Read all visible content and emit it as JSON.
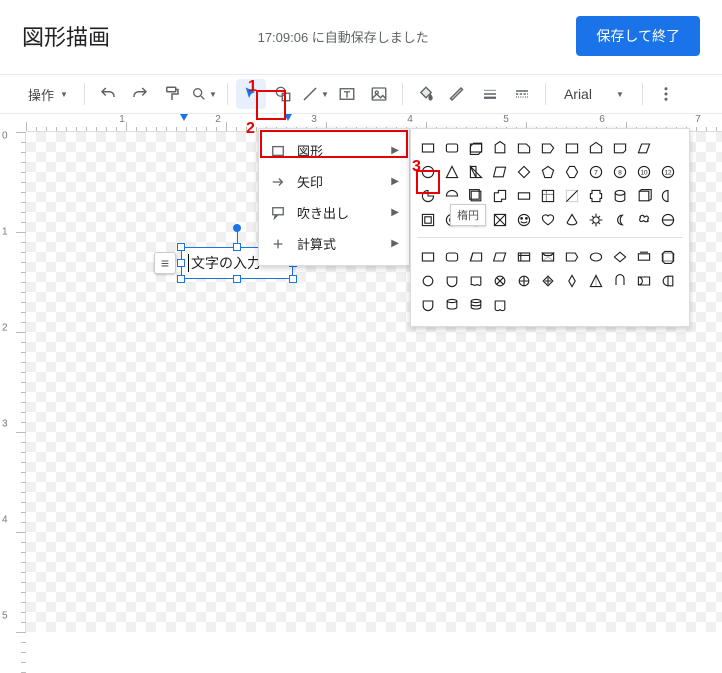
{
  "header": {
    "title": "図形描画",
    "status": "17:09:06 に自動保存しました",
    "save_button": "保存して終了"
  },
  "toolbar": {
    "actions_label": "操作",
    "font_name": "Arial"
  },
  "menu": {
    "items": [
      {
        "label": "図形",
        "icon": "rect"
      },
      {
        "label": "矢印",
        "icon": "arrow"
      },
      {
        "label": "吹き出し",
        "icon": "callout"
      },
      {
        "label": "計算式",
        "icon": "plus"
      }
    ]
  },
  "canvas": {
    "textbox_value": "文字の入力"
  },
  "tooltip": "楕円",
  "annotations": {
    "one": "1",
    "two": "2",
    "three": "3"
  },
  "ruler": {
    "h_labels": [
      "1",
      "2",
      "3",
      "4",
      "5",
      "6",
      "7"
    ],
    "v_labels": [
      "0",
      "1",
      "2",
      "3",
      "4",
      "5"
    ]
  }
}
